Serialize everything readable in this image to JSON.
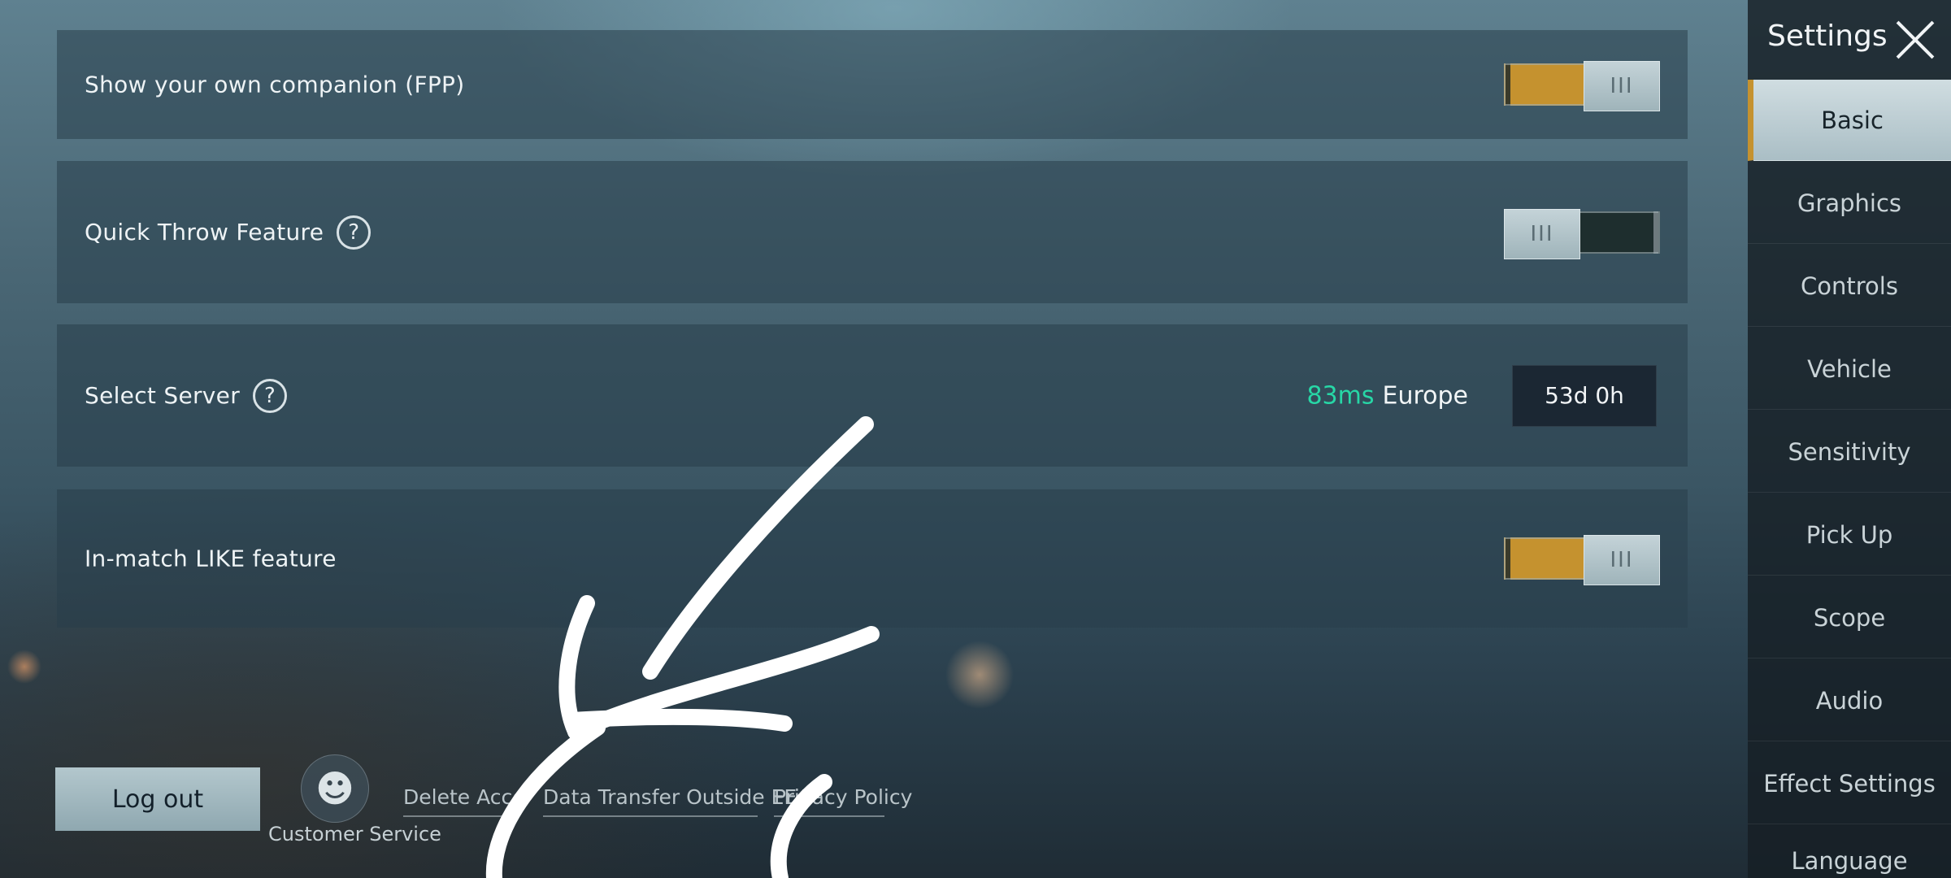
{
  "rows": {
    "companion": {
      "label": "Show your own companion (FPP)",
      "state": "on",
      "knob": "III"
    },
    "quick_throw": {
      "label": "Quick Throw Feature",
      "help": "?",
      "state": "off",
      "knob": "III"
    },
    "server": {
      "label": "Select Server",
      "help": "?",
      "ping": "83ms",
      "region": "Europe",
      "time": "53d 0h"
    },
    "like": {
      "label": "In-match LIKE feature",
      "state": "on",
      "knob": "III"
    }
  },
  "sidebar": {
    "title": "Settings",
    "items": [
      {
        "label": "Basic",
        "active": true
      },
      {
        "label": "Graphics"
      },
      {
        "label": "Controls"
      },
      {
        "label": "Vehicle"
      },
      {
        "label": "Sensitivity"
      },
      {
        "label": "Pick Up"
      },
      {
        "label": "Scope"
      },
      {
        "label": "Audio"
      },
      {
        "label": "Effect Settings"
      },
      {
        "label": "Language"
      }
    ]
  },
  "bottom": {
    "logout": "Log out",
    "customer_service": "Customer Service",
    "links": [
      "Delete Account",
      "Data Transfer Outside EEA",
      "Privacy Policy"
    ]
  },
  "colors": {
    "toggle_on": "#c5922f",
    "ping_good": "#27d7a6",
    "active_nav": "#c5922f"
  },
  "icons": {
    "help": "help-circle-icon",
    "close": "close-icon",
    "customer_service": "headset-icon"
  }
}
